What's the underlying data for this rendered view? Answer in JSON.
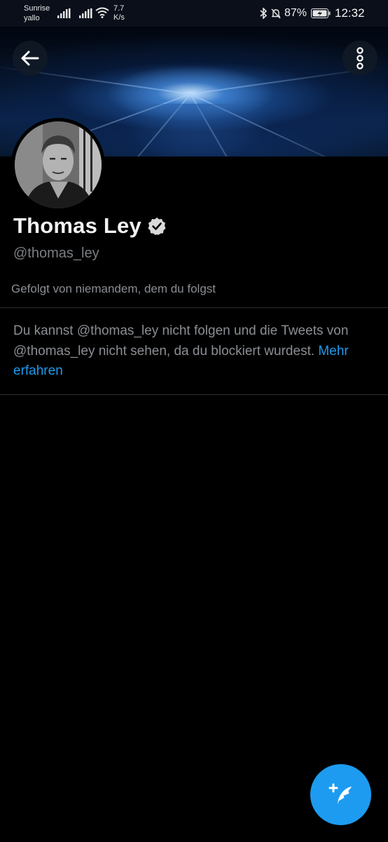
{
  "status_bar": {
    "carrier_line1": "Sunrise",
    "carrier_line2": "yallo",
    "net_speed_value": "7.7",
    "net_speed_unit": "K/s",
    "battery_percent": "87%",
    "time": "12:32",
    "icons": [
      "signal-icon",
      "signal-icon",
      "wifi-icon",
      "bluetooth-icon",
      "mute-icon",
      "battery-charging-icon"
    ]
  },
  "header": {
    "back_icon": "arrow-left-icon",
    "more_icon": "more-vertical-icon"
  },
  "profile": {
    "name": "Thomas Ley",
    "verified": true,
    "handle": "@thomas_ley",
    "followed_by": "Gefolgt von niemandem, dem du folgst"
  },
  "blocked_notice": {
    "text": "Du kannst @thomas_ley nicht folgen und die Tweets von @thomas_ley nicht sehen, da du blockiert wurdest.",
    "link_label": "Mehr erfahren"
  },
  "fab": {
    "icon": "compose-tweet-icon"
  },
  "colors": {
    "background": "#000000",
    "accent": "#1d9bf0",
    "secondary_text": "#8a8e93",
    "divider": "#2a2d31"
  }
}
